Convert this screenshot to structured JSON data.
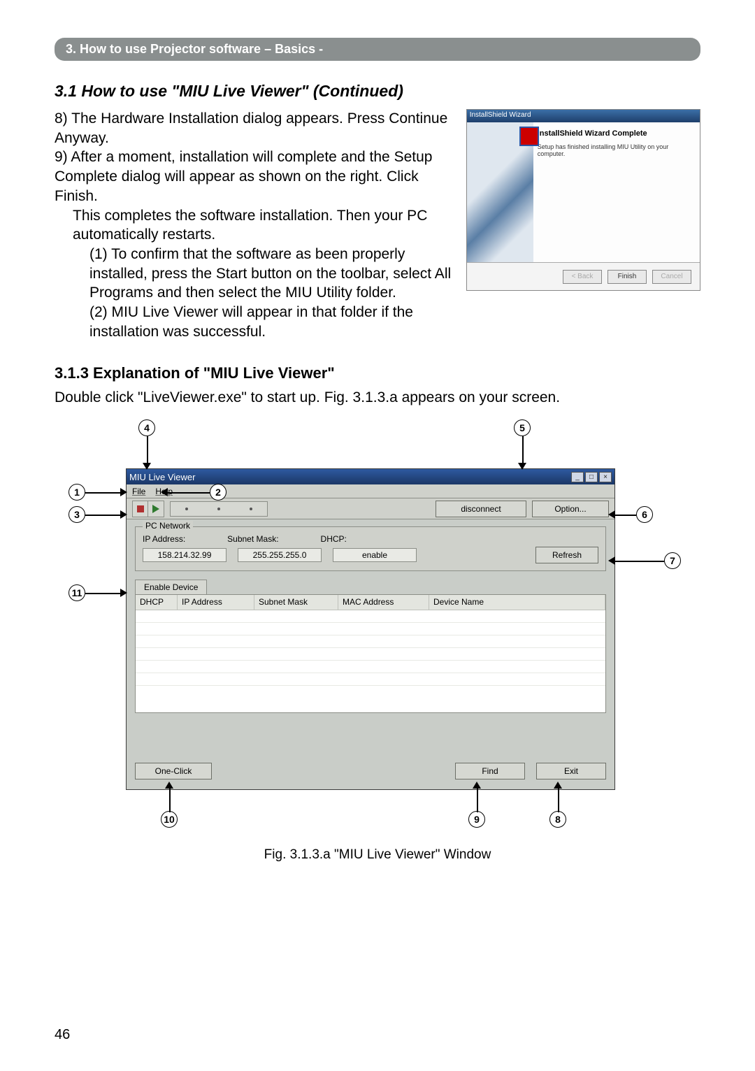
{
  "header": {
    "breadcrumb": "3. How to use Projector software – Basics -"
  },
  "section": {
    "title": "3.1 How to use \"MIU Live Viewer\" (Continued)",
    "step8": "8) The Hardware Installation dialog appears. Press Continue Anyway.",
    "step9a": "9) After a moment, installation will complete and the Setup Complete dialog will appear as shown on the right. Click Finish.",
    "step9b": "This completes the software installation. Then your PC automatically restarts.",
    "step9c": "(1) To confirm that the software as been properly installed, press the Start button on the toolbar, select All Programs and then select the MIU Utility folder.",
    "step9d": "(2) MIU Live Viewer will appear in that folder if the installation was successful."
  },
  "wizard": {
    "titlebar": "InstallShield Wizard",
    "heading": "InstallShield Wizard Complete",
    "body": "Setup has finished installing MIU Utility on your computer.",
    "btn_back": "< Back",
    "btn_finish": "Finish",
    "btn_cancel": "Cancel"
  },
  "subsection": {
    "heading": "3.1.3 Explanation of \"MIU Live Viewer\"",
    "intro": "Double click \"LiveViewer.exe\" to start up. Fig. 3.1.3.a appears on your screen."
  },
  "app": {
    "title": "MIU Live Viewer",
    "menu": {
      "file": "File",
      "help": "Help"
    },
    "toolbar": {
      "disconnect": "disconnect",
      "option": "Option..."
    },
    "groupbox": {
      "legend": "PC Network",
      "labels": {
        "ip": "IP Address:",
        "mask": "Subnet Mask:",
        "dhcp": "DHCP:"
      },
      "values": {
        "ip": "158.214.32.99",
        "mask": "255.255.255.0",
        "dhcp": "enable"
      },
      "refresh": "Refresh"
    },
    "tab": "Enable Device",
    "columns": {
      "c1": "DHCP",
      "c2": "IP Address",
      "c3": "Subnet Mask",
      "c4": "MAC Address",
      "c5": "Device Name"
    },
    "buttons": {
      "oneclick": "One-Click",
      "find": "Find",
      "exit": "Exit"
    },
    "winctl": {
      "min": "_",
      "max": "□",
      "close": "×"
    }
  },
  "callouts": {
    "n1": "1",
    "n2": "2",
    "n3": "3",
    "n4": "4",
    "n5": "5",
    "n6": "6",
    "n7": "7",
    "n8": "8",
    "n9": "9",
    "n10": "10",
    "n11": "11"
  },
  "figure_caption": "Fig. 3.1.3.a \"MIU Live Viewer\" Window",
  "page_number": "46"
}
